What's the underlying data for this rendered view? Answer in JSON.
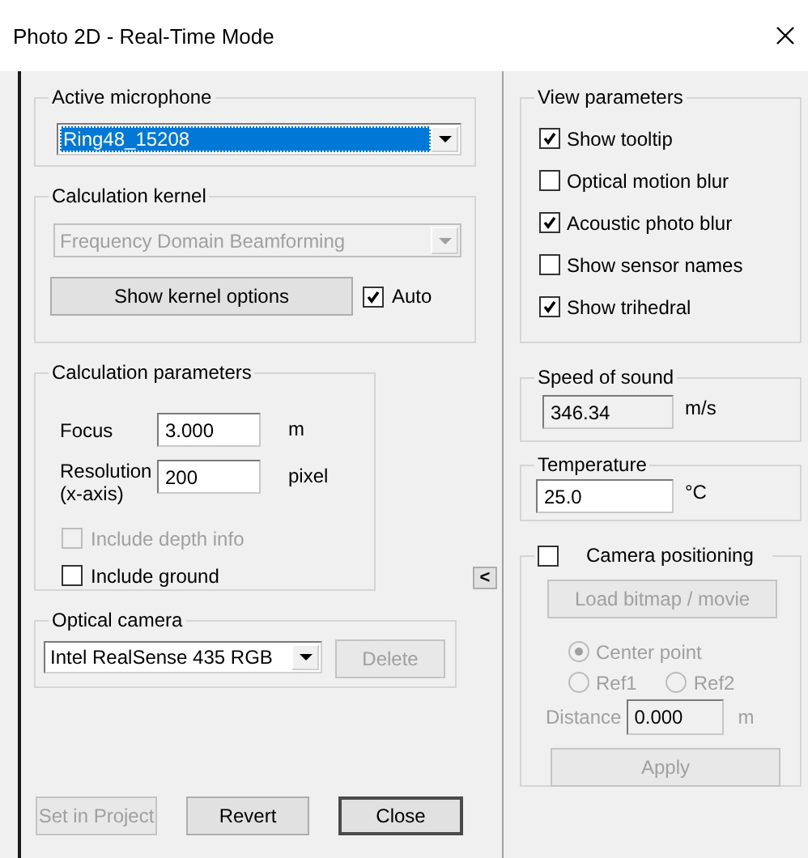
{
  "window": {
    "title": "Photo 2D - Real-Time Mode"
  },
  "active_microphone": {
    "label": "Active microphone",
    "value": "Ring48_15208",
    "selected": true,
    "disabled": false
  },
  "calculation_kernel": {
    "label": "Calculation kernel",
    "value": "Frequency Domain Beamforming",
    "disabled": true,
    "options_button": {
      "label": "Show kernel options",
      "disabled": false
    },
    "auto": {
      "label": "Auto",
      "checked": true,
      "disabled": false
    }
  },
  "calculation_parameters": {
    "label": "Calculation parameters",
    "fields": [
      {
        "label": "Focus",
        "value": "3.000",
        "unit": "m"
      },
      {
        "label": "Resolution\n(x-axis)",
        "value": "200",
        "unit": "pixel"
      }
    ],
    "options": [
      {
        "label": "Include depth info",
        "checked": false,
        "disabled": true
      },
      {
        "label": "Include ground",
        "checked": false,
        "disabled": false
      }
    ]
  },
  "collapse_button": {
    "label": "<"
  },
  "optical_camera": {
    "label": "Optical camera",
    "value": "Intel RealSense 435 RGB",
    "disabled": false,
    "delete_button": {
      "label": "Delete",
      "disabled": true
    }
  },
  "buttons": [
    {
      "label": "Set in Project",
      "disabled": true,
      "default": false
    },
    {
      "label": "Revert",
      "disabled": false,
      "default": false
    },
    {
      "label": "Close",
      "disabled": false,
      "default": true
    }
  ],
  "view_parameters": {
    "label": "View parameters",
    "options": [
      {
        "label": "Show tooltip",
        "checked": true,
        "disabled": false
      },
      {
        "label": "Optical motion blur",
        "checked": false,
        "disabled": false
      },
      {
        "label": "Acoustic photo blur",
        "checked": true,
        "disabled": false
      },
      {
        "label": "Show sensor names",
        "checked": false,
        "disabled": false
      },
      {
        "label": "Show trihedral",
        "checked": true,
        "disabled": false
      }
    ]
  },
  "speed_of_sound": {
    "label": "Speed of sound",
    "value": "346.34",
    "unit": "m/s",
    "disabled": true
  },
  "temperature": {
    "label": "Temperature",
    "value": "25.0",
    "unit": "°C",
    "disabled": false
  },
  "camera_positioning": {
    "label": "Camera positioning",
    "checked": false,
    "disabled": true,
    "load_button": {
      "label": "Load bitmap / movie"
    },
    "radios": [
      {
        "label": "Center point",
        "selected": true
      },
      {
        "label": "Ref1",
        "selected": false
      },
      {
        "label": "Ref2",
        "selected": false
      }
    ],
    "distance": {
      "label": "Distance",
      "value": "0.000",
      "unit": "m"
    },
    "apply_button": {
      "label": "Apply"
    }
  }
}
